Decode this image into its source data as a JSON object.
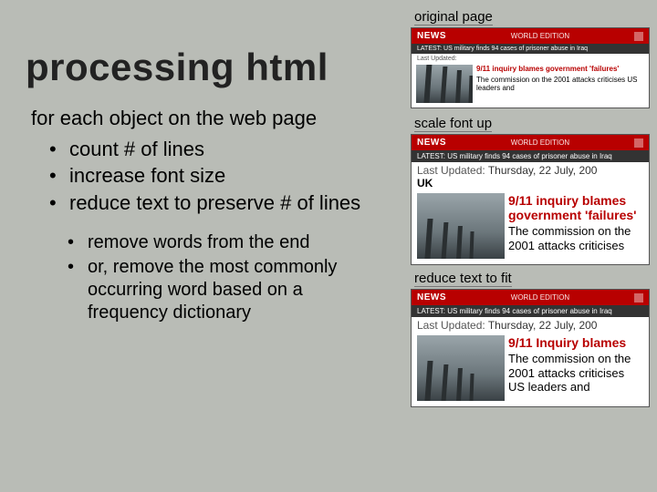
{
  "title": "processing html",
  "lead": "for each object on the web page",
  "bullets": [
    "count # of lines",
    "increase font size",
    "reduce text to preserve # of lines"
  ],
  "subbullets": [
    "remove words from the end",
    "or, remove the most commonly occurring word based on a frequency dictionary"
  ],
  "captions": {
    "original": "original page",
    "scaled": "scale font up",
    "reduced": "reduce text to fit"
  },
  "sample": {
    "brand": "NEWS",
    "edition": "WORLD EDITION",
    "latest": "LATEST: US military finds 94 cases of prisoner abuse in Iraq",
    "last_updated_label": "Last Updated:",
    "last_updated_value": "Thursday, 22 July, 200",
    "country": "UK"
  },
  "story_small": {
    "headline": "9/11 inquiry blames government 'failures'",
    "copy": "The commission on the 2001 attacks criticises US leaders and"
  },
  "story_mid": {
    "headline": "9/11 inquiry blames government 'failures'",
    "copy": "The commission on the 2001 attacks criticises"
  },
  "story_big": {
    "headline": "9/11 Inquiry blames",
    "copy": "The commission on the 2001 attacks criticises US leaders and"
  }
}
